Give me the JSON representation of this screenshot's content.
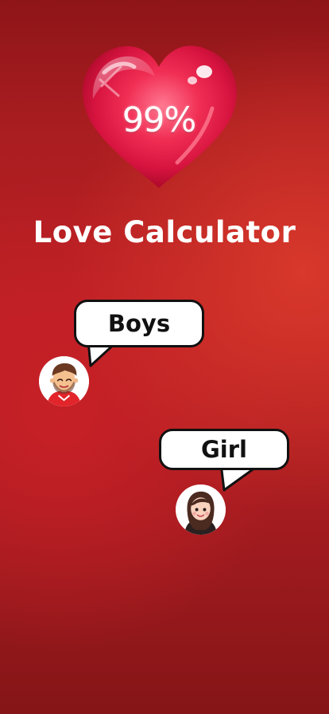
{
  "app": {
    "title": "Love Calculator"
  },
  "heart": {
    "percentage": "99%",
    "icon": "heart-icon",
    "color": "#e3163e"
  },
  "options": [
    {
      "label": "Boys",
      "avatar_icon": "boy-avatar-icon"
    },
    {
      "label": "Girl",
      "avatar_icon": "girl-avatar-icon"
    }
  ],
  "colors": {
    "background": "#b41f22",
    "bubble": "#ffffff",
    "bubble_border": "#111111",
    "text_light": "#ffffff",
    "text_dark": "#111111"
  }
}
